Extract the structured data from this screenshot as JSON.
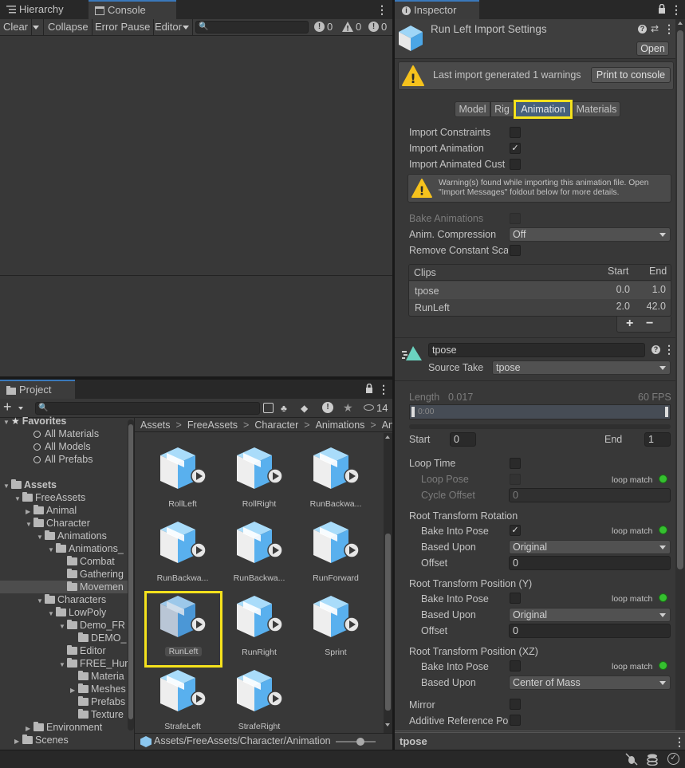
{
  "tabs": {
    "hierarchy": "Hierarchy",
    "console": "Console",
    "inspector": "Inspector",
    "project": "Project"
  },
  "console": {
    "clear": "Clear",
    "collapse": "Collapse",
    "error_pause": "Error Pause",
    "editor": "Editor",
    "count_info": "0",
    "count_warn": "0",
    "count_error": "0"
  },
  "project": {
    "add": "+",
    "hidden_count": "14",
    "breadcrumb": [
      "Assets",
      "FreeAssets",
      "Character",
      "Animations",
      "Anim"
    ],
    "footer_path": "Assets/FreeAssets/Character/Animation",
    "tree": [
      {
        "label": "Favorites",
        "indent": 0,
        "tri": "▼",
        "icon": "star",
        "bold": true
      },
      {
        "label": "All Materials",
        "indent": 2,
        "tri": "",
        "icon": "search"
      },
      {
        "label": "All Models",
        "indent": 2,
        "tri": "",
        "icon": "search"
      },
      {
        "label": "All Prefabs",
        "indent": 2,
        "tri": "",
        "icon": "search"
      },
      {
        "label": "",
        "indent": 0,
        "tri": "",
        "icon": "none"
      },
      {
        "label": "Assets",
        "indent": 0,
        "tri": "▼",
        "icon": "folder",
        "bold": true
      },
      {
        "label": "FreeAssets",
        "indent": 1,
        "tri": "▼",
        "icon": "folder"
      },
      {
        "label": "Animal",
        "indent": 2,
        "tri": "▶",
        "icon": "folder"
      },
      {
        "label": "Character",
        "indent": 2,
        "tri": "▼",
        "icon": "folder"
      },
      {
        "label": "Animations",
        "indent": 3,
        "tri": "▼",
        "icon": "folder"
      },
      {
        "label": "Animations_",
        "indent": 4,
        "tri": "▼",
        "icon": "folder"
      },
      {
        "label": "Combat",
        "indent": 5,
        "tri": "",
        "icon": "folder"
      },
      {
        "label": "Gathering",
        "indent": 5,
        "tri": "",
        "icon": "folder"
      },
      {
        "label": "Movemen",
        "indent": 5,
        "tri": "",
        "icon": "folder",
        "selected": true
      },
      {
        "label": "Characters",
        "indent": 3,
        "tri": "▼",
        "icon": "folder"
      },
      {
        "label": "LowPoly",
        "indent": 4,
        "tri": "▼",
        "icon": "folder"
      },
      {
        "label": "Demo_FR",
        "indent": 5,
        "tri": "▼",
        "icon": "folder"
      },
      {
        "label": "DEMO_",
        "indent": 6,
        "tri": "",
        "icon": "folder"
      },
      {
        "label": "Editor",
        "indent": 5,
        "tri": "",
        "icon": "folder"
      },
      {
        "label": "FREE_Hur",
        "indent": 5,
        "tri": "▼",
        "icon": "folder"
      },
      {
        "label": "Materia",
        "indent": 6,
        "tri": "",
        "icon": "folder"
      },
      {
        "label": "Meshes",
        "indent": 6,
        "tri": "▶",
        "icon": "folder"
      },
      {
        "label": "Prefabs",
        "indent": 6,
        "tri": "",
        "icon": "folder"
      },
      {
        "label": "Texture",
        "indent": 6,
        "tri": "",
        "icon": "folder"
      },
      {
        "label": "Environment",
        "indent": 2,
        "tri": "▶",
        "icon": "folder"
      },
      {
        "label": "Scenes",
        "indent": 1,
        "tri": "▶",
        "icon": "folder"
      }
    ],
    "assets": [
      {
        "name": "RollLeft"
      },
      {
        "name": "RollRight"
      },
      {
        "name": "RunBackwa..."
      },
      {
        "name": "RunBackwa..."
      },
      {
        "name": "RunBackwa..."
      },
      {
        "name": "RunForward"
      },
      {
        "name": "RunLeft",
        "selected": true
      },
      {
        "name": "RunRight"
      },
      {
        "name": "Sprint"
      },
      {
        "name": "StrafeLeft"
      },
      {
        "name": "StrafeRight"
      }
    ]
  },
  "inspector": {
    "title": "Run Left Import Settings",
    "open": "Open",
    "warning_text": "Last import generated 1 warnings",
    "print_console": "Print to console",
    "subtabs": [
      "Model",
      "Rig",
      "Animation",
      "Materials"
    ],
    "import_constraints": "Import Constraints",
    "import_animation": "Import Animation",
    "import_animated_custom": "Import Animated Cust",
    "anim_warning": "Warning(s) found while importing this animation file. Open \"Import Messages\" foldout below for more details.",
    "bake_animations": "Bake Animations",
    "anim_compression": "Anim. Compression",
    "anim_compression_value": "Off",
    "remove_constant": "Remove Constant Sca",
    "clips_header": "Clips",
    "start_header": "Start",
    "end_header": "End",
    "clips": [
      {
        "name": "tpose",
        "start": "0.0",
        "end": "1.0"
      },
      {
        "name": "RunLeft",
        "start": "2.0",
        "end": "42.0"
      }
    ],
    "plus": "+",
    "minus": "−",
    "clip_name": "tpose",
    "source_take": "Source Take",
    "source_take_value": "tpose",
    "length_label": "Length",
    "length_value": "0.017",
    "fps": "60 FPS",
    "timeline_value": "0:00",
    "start_label": "Start",
    "start_value": "0",
    "end_label": "End",
    "end_value": "1",
    "loop_time": "Loop Time",
    "loop_pose": "Loop Pose",
    "loop_match": "loop match",
    "cycle_offset": "Cycle Offset",
    "cycle_offset_value": "0",
    "root_rotation": "Root Transform Rotation",
    "bake_into_pose": "Bake Into Pose",
    "based_upon": "Based Upon",
    "original": "Original",
    "offset": "Offset",
    "offset_value": "0",
    "root_position_y": "Root Transform Position (Y)",
    "root_position_xz": "Root Transform Position (XZ)",
    "center_of_mass": "Center of Mass",
    "mirror": "Mirror",
    "additive_ref": "Additive Reference Po",
    "footer_name": "tpose"
  },
  "colors": {
    "highlight": "#f5e21d",
    "accent": "#3a79bb",
    "asset_blue": "#5fb6f0",
    "green": "#35c02f"
  }
}
